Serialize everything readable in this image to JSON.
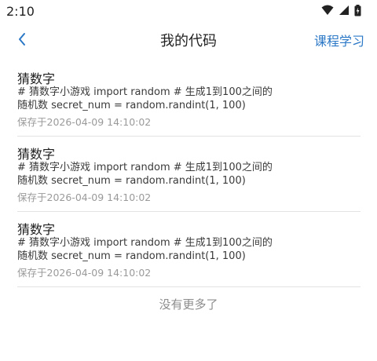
{
  "status": {
    "time": "2:10"
  },
  "nav": {
    "title": "我的代码",
    "right": "课程学习"
  },
  "items": [
    {
      "title": "猜数字",
      "snippet": "# 猜数字小游戏 import random # 生成1到100之间的随机数 secret_num = random.randint(1, 100) print(\"=== 欢迎来到猜数字游戏 ===\")",
      "saved": "保存于2026-04-09 14:10:02"
    },
    {
      "title": "猜数字",
      "snippet": "# 猜数字小游戏 import random # 生成1到100之间的随机数 secret_num = random.randint(1, 100) print(\"=== 欢迎来到猜数字游戏 ===\")",
      "saved": "保存于2026-04-09 14:10:02"
    },
    {
      "title": "猜数字",
      "snippet": "# 猜数字小游戏 import random # 生成1到100之间的随机数 secret_num = random.randint(1, 100) print(\"=== 欢迎来到猜数字游戏 ===\")",
      "saved": "保存于2026-04-09 14:10:02"
    }
  ],
  "footer": {
    "no_more": "没有更多了"
  },
  "colors": {
    "accent": "#2b78c6",
    "divider": "#e3e3e3",
    "muted": "#9a9a9a"
  },
  "icons": [
    "wifi-icon",
    "signal-icon",
    "battery-icon",
    "back-arrow-icon"
  ]
}
